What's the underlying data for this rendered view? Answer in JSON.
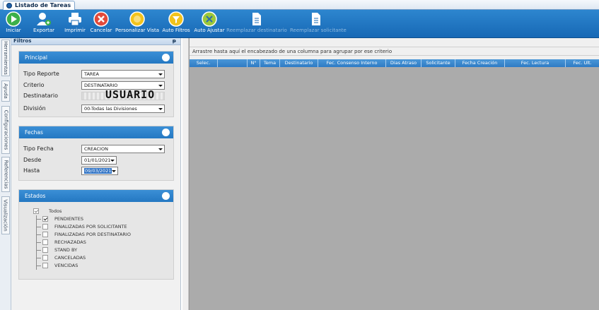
{
  "window": {
    "tab_title": "Listado de Tareas"
  },
  "toolbar": [
    {
      "id": "iniciar",
      "label": "Iniciar",
      "icon": "play-icon",
      "enabled": true
    },
    {
      "id": "exportar",
      "label": "Exportar",
      "icon": "user-export-icon",
      "enabled": true
    },
    {
      "id": "imprimir",
      "label": "Imprimir",
      "icon": "printer-icon",
      "enabled": true
    },
    {
      "id": "cancelar",
      "label": "Cancelar",
      "icon": "cancel-icon",
      "enabled": true
    },
    {
      "id": "personalizar",
      "label": "Personalizar Vista",
      "icon": "customize-view-icon",
      "enabled": true
    },
    {
      "id": "autofiltros",
      "label": "Auto Filtros",
      "icon": "auto-filter-icon",
      "enabled": true
    },
    {
      "id": "autoajustar",
      "label": "Auto Ajustar",
      "icon": "auto-fit-icon",
      "enabled": true
    },
    {
      "id": "reemp_dest",
      "label": "Reemplazar destinatario",
      "icon": "document-icon",
      "enabled": false
    },
    {
      "id": "reemp_sol",
      "label": "Reemplazar solicitante",
      "icon": "document-icon",
      "enabled": false
    }
  ],
  "side_tabs": [
    "Herramientas",
    "Ayuda",
    "Configuraciones",
    "Referencias",
    "Visualización"
  ],
  "filters": {
    "header": "Filtros",
    "pin": "ᵽ",
    "principal": {
      "title": "Principal",
      "tipo_reporte": {
        "label": "Tipo Reporte",
        "value": "TAREA"
      },
      "criterio": {
        "label": "Criterio",
        "value": "DESTINATARIO"
      },
      "destinatario": {
        "label": "Destinatario",
        "value": "USUARIO"
      },
      "division": {
        "label": "División",
        "value": "00-Todas las Divisiones"
      }
    },
    "fechas": {
      "title": "Fechas",
      "tipo_fecha": {
        "label": "Tipo Fecha",
        "value": "CREACION"
      },
      "desde": {
        "label": "Desde",
        "value": "01/01/2021"
      },
      "hasta": {
        "label": "Hasta",
        "value": "09/03/2021"
      }
    },
    "estados": {
      "title": "Estados",
      "root": {
        "label": "Todos",
        "checked": true
      },
      "items": [
        {
          "label": "PENDIENTES",
          "checked": true
        },
        {
          "label": "FINALIZADAS POR SOLICITANTE",
          "checked": false
        },
        {
          "label": "FINALIZADAS POR DESTINATARIO",
          "checked": false
        },
        {
          "label": "RECHAZADAS",
          "checked": false
        },
        {
          "label": "STAND BY",
          "checked": false
        },
        {
          "label": "CANCELADAS",
          "checked": false
        },
        {
          "label": "VENCIDAS",
          "checked": false
        }
      ]
    }
  },
  "grid": {
    "group_hint": "Arrastre hasta aquí el encabezado de una columna para agrupar por ese criterio",
    "columns": [
      "Selec.",
      "",
      "N°",
      "Tema",
      "Destinatario",
      "Fec. Consenso Interno",
      "Dias Atraso",
      "Solicitante",
      "Fecha Creación",
      "Fec. Lectura",
      "Fec. Ult."
    ]
  },
  "colors": {
    "toolbar": "#1768b5",
    "group_header": "#2478c2",
    "grid_bg": "#ababab"
  }
}
